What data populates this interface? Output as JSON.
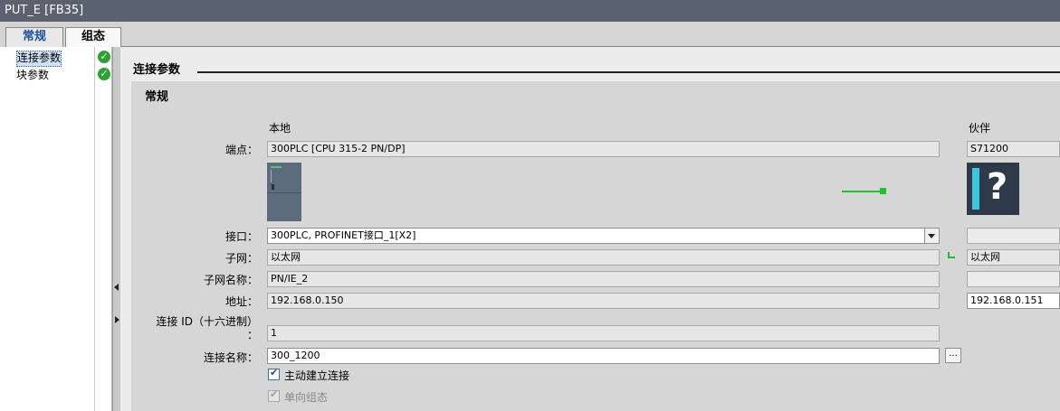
{
  "window": {
    "title": "PUT_E [FB35]"
  },
  "tabs": [
    {
      "label": "常规"
    },
    {
      "label": "组态"
    }
  ],
  "nav": {
    "items": [
      {
        "label": "连接参数",
        "selected": true,
        "status": "check"
      },
      {
        "label": "块参数",
        "selected": false,
        "status": "check"
      }
    ]
  },
  "section": {
    "title": "连接参数",
    "group_title": "常规"
  },
  "columns": {
    "local": "本地",
    "partner": "伙伴"
  },
  "labels": {
    "endpoint": "端点：",
    "interface": "接口：",
    "subnet": "子网：",
    "subnet_name": "子网名称：",
    "address": "地址：",
    "conn_id_line1": "连接 ID（十六进制）",
    "conn_id_line2": "：",
    "conn_name": "连接名称："
  },
  "local": {
    "endpoint": "300PLC [CPU 315-2 PN/DP]",
    "interface": "300PLC, PROFINET接口_1[X2]",
    "subnet": "以太网",
    "subnet_name": "PN/IE_2",
    "address": "192.168.0.150",
    "conn_id": "1",
    "conn_name": "300_1200",
    "conn_name_button": "..."
  },
  "partner": {
    "endpoint": "S71200",
    "interface": "",
    "subnet": "以太网",
    "subnet_name": "",
    "address": "192.168.0.151"
  },
  "options": {
    "active_connection": {
      "label": "主动建立连接",
      "checked": true,
      "enabled": true
    },
    "one_way": {
      "label": "单向组态",
      "checked": true,
      "enabled": false
    }
  },
  "colors": {
    "title_bar": "#59626e",
    "status_ok": "#2ea12e",
    "link": "#22c22e",
    "tab_active_text": "#1d4ea0"
  }
}
